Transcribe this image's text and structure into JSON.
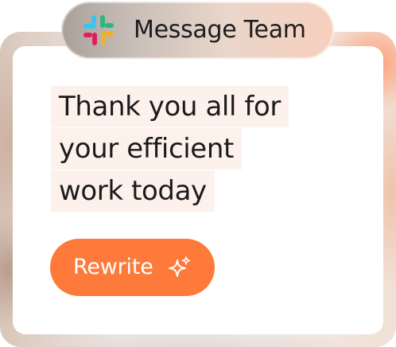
{
  "header": {
    "app_icon": "slack-logo-icon",
    "title": "Message Team"
  },
  "message": {
    "lines": [
      "Thank you all for",
      "your efficient",
      "work today"
    ]
  },
  "actions": {
    "rewrite_label": "Rewrite",
    "rewrite_icon": "sparkle-icon"
  },
  "colors": {
    "accent": "#fd7a3b",
    "highlight": "#fdf1ec",
    "text": "#1b1b1b"
  }
}
